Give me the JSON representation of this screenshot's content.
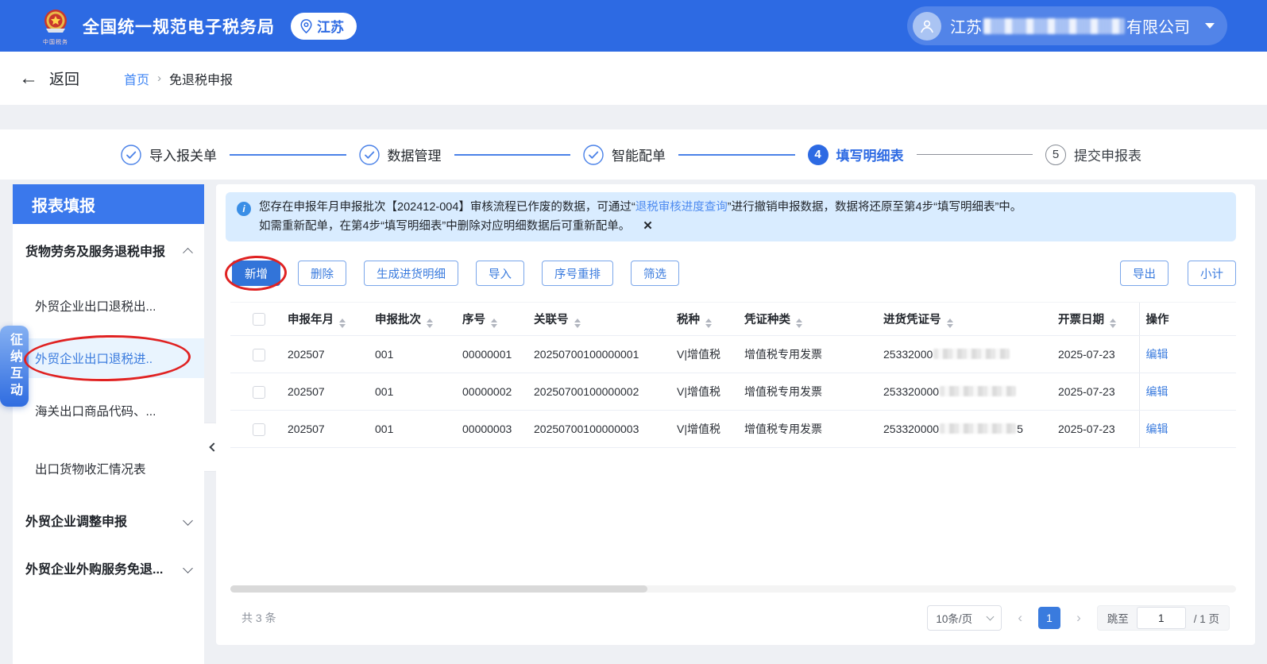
{
  "header": {
    "app_title": "全国统一规范电子税务局",
    "region": "江苏",
    "logo_caption": "中国税务",
    "user_company_prefix": "江苏",
    "user_company_suffix": "有限公司"
  },
  "breadcrumb": {
    "back_label": "返回",
    "home": "首页",
    "separator": "›",
    "current": "免退税申报"
  },
  "steps": {
    "s1": "导入报关单",
    "s2": "数据管理",
    "s3": "智能配单",
    "s4": "填写明细表",
    "s5": "提交申报表",
    "n4": "4",
    "n5": "5"
  },
  "sidebar": {
    "panel_title": "报表填报",
    "floating_tab": "征纳互动",
    "group1": "货物劳务及服务退税申报",
    "item1": "外贸企业出口退税出...",
    "item2": "外贸企业出口退税进..",
    "item3": "海关出口商品代码、...",
    "item4": "出口货物收汇情况表",
    "group2": "外贸企业调整申报",
    "group3": "外贸企业外购服务免退..."
  },
  "banner": {
    "line1_pre": "您存在申报年月申报批次【202412-004】审核流程已作废的数据，可通过“",
    "link": "退税审核进度查询",
    "line1_post": "”进行撤销申报数据，数据将还原至第4步“填写明细表”中。",
    "line2": "如需重新配单，在第4步“填写明细表”中删除对应明细数据后可重新配单。",
    "close": "✕"
  },
  "toolbar": {
    "add": "新增",
    "delete": "删除",
    "generate": "生成进货明细",
    "import": "导入",
    "reorder": "序号重排",
    "filter": "筛选",
    "export": "导出",
    "subtotal": "小计"
  },
  "table": {
    "columns": {
      "period": "申报年月",
      "batch": "申报批次",
      "seq": "序号",
      "rel": "关联号",
      "tax": "税种",
      "voucher_type": "凭证种类",
      "voucher_no": "进货凭证号",
      "date": "开票日期",
      "action": "操作"
    },
    "rows": [
      {
        "period": "202507",
        "batch": "001",
        "seq": "00000001",
        "rel": "20250700100000001",
        "tax": "V|增值税",
        "voucher_type": "增值税专用发票",
        "voucher_prefix": "25332000",
        "voucher_suffix": "",
        "date": "2025-07-23",
        "action": "编辑"
      },
      {
        "period": "202507",
        "batch": "001",
        "seq": "00000002",
        "rel": "20250700100000002",
        "tax": "V|增值税",
        "voucher_type": "增值税专用发票",
        "voucher_prefix": "253320000",
        "voucher_suffix": "",
        "date": "2025-07-23",
        "action": "编辑"
      },
      {
        "period": "202507",
        "batch": "001",
        "seq": "00000003",
        "rel": "20250700100000003",
        "tax": "V|增值税",
        "voucher_type": "增值税专用发票",
        "voucher_prefix": "253320000",
        "voucher_suffix": "5",
        "date": "2025-07-23",
        "action": "编辑"
      }
    ]
  },
  "footer": {
    "total": "共 3 条",
    "page_size": "10条/页",
    "current_page": "1",
    "jump_label": "跳至",
    "jump_value": "1",
    "total_pages": "/ 1 页"
  },
  "colors": {
    "header_blue": "#2d6ae3",
    "accent_blue": "#3a7bde",
    "banner_bg": "#d9ecff",
    "annotation_red": "#e02222"
  }
}
